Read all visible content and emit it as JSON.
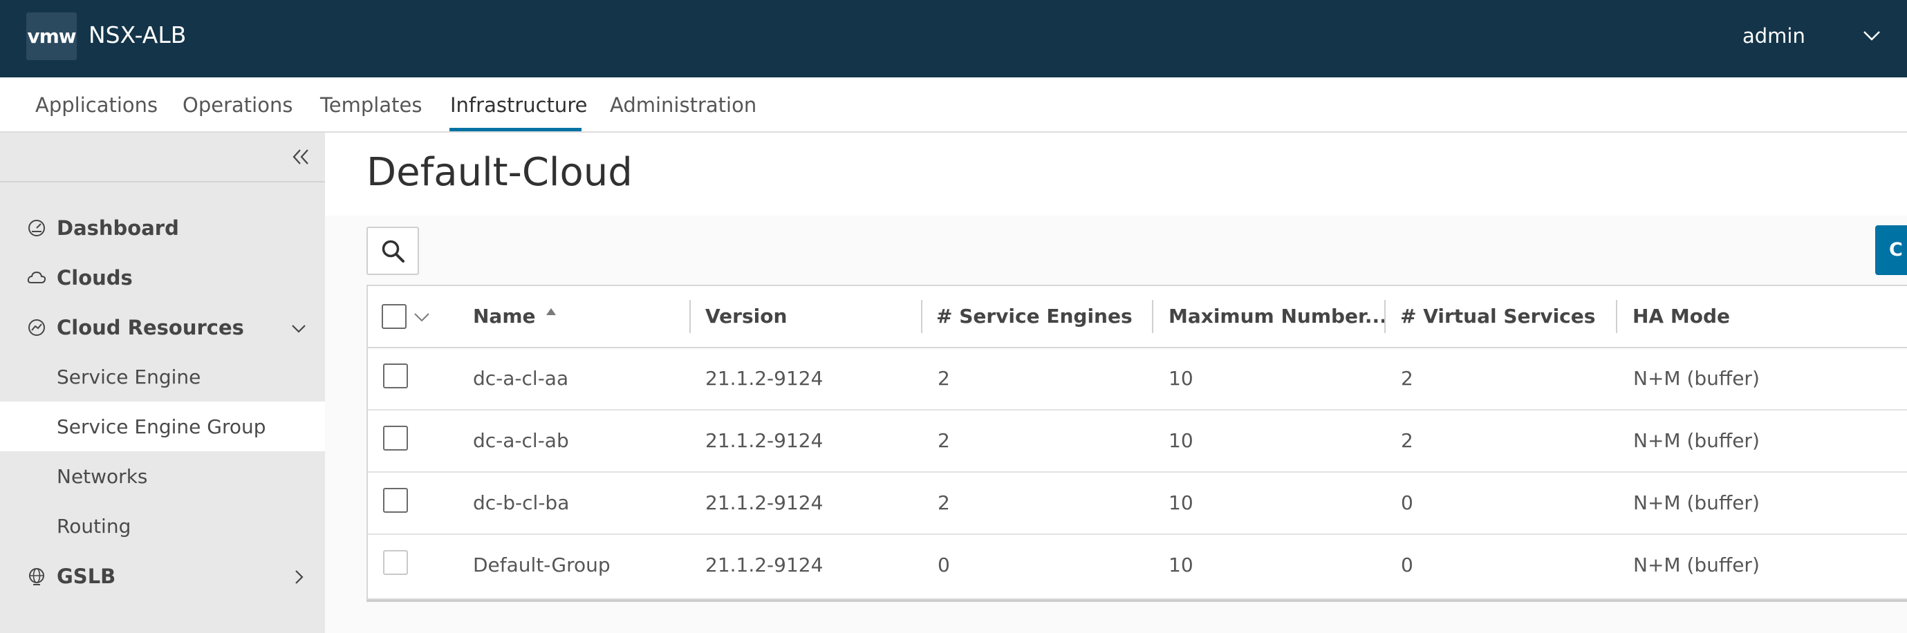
{
  "header": {
    "logo_text": "vmw",
    "product": "NSX-ALB",
    "user": "admin"
  },
  "nav": {
    "tabs": [
      {
        "label": "Applications"
      },
      {
        "label": "Operations"
      },
      {
        "label": "Templates"
      },
      {
        "label": "Infrastructure",
        "active": true
      },
      {
        "label": "Administration"
      }
    ]
  },
  "sidebar": {
    "items": [
      {
        "label": "Dashboard",
        "icon": "dashboard-icon"
      },
      {
        "label": "Clouds",
        "icon": "cloud-icon"
      },
      {
        "label": "Cloud Resources",
        "icon": "cloud-resources-icon",
        "expanded": true
      },
      {
        "label": "GSLB",
        "icon": "globe-icon",
        "expanded": false
      }
    ],
    "sub_items": [
      {
        "label": "Service Engine"
      },
      {
        "label": "Service Engine Group",
        "active": true
      },
      {
        "label": "Networks"
      },
      {
        "label": "Routing"
      }
    ]
  },
  "main": {
    "title": "Default-Cloud",
    "create_label": "C",
    "table": {
      "columns": [
        "Name",
        "Version",
        "# Service Engines",
        "Maximum Number...",
        "# Virtual Services",
        "HA Mode"
      ],
      "sort_column": "Name",
      "rows": [
        {
          "name": "dc-a-cl-aa",
          "version": "21.1.2-9124",
          "service_engines": "2",
          "max_number": "10",
          "virtual_services": "2",
          "ha_mode": "N+M (buffer)"
        },
        {
          "name": "dc-a-cl-ab",
          "version": "21.1.2-9124",
          "service_engines": "2",
          "max_number": "10",
          "virtual_services": "2",
          "ha_mode": "N+M (buffer)"
        },
        {
          "name": "dc-b-cl-ba",
          "version": "21.1.2-9124",
          "service_engines": "2",
          "max_number": "10",
          "virtual_services": "0",
          "ha_mode": "N+M (buffer)"
        },
        {
          "name": "Default-Group",
          "version": "21.1.2-9124",
          "service_engines": "0",
          "max_number": "10",
          "virtual_services": "0",
          "ha_mode": "N+M (buffer)"
        }
      ]
    }
  },
  "colors": {
    "header_bg": "#133449",
    "accent": "#0072a3",
    "sidebar_bg": "#e8e8e8"
  }
}
